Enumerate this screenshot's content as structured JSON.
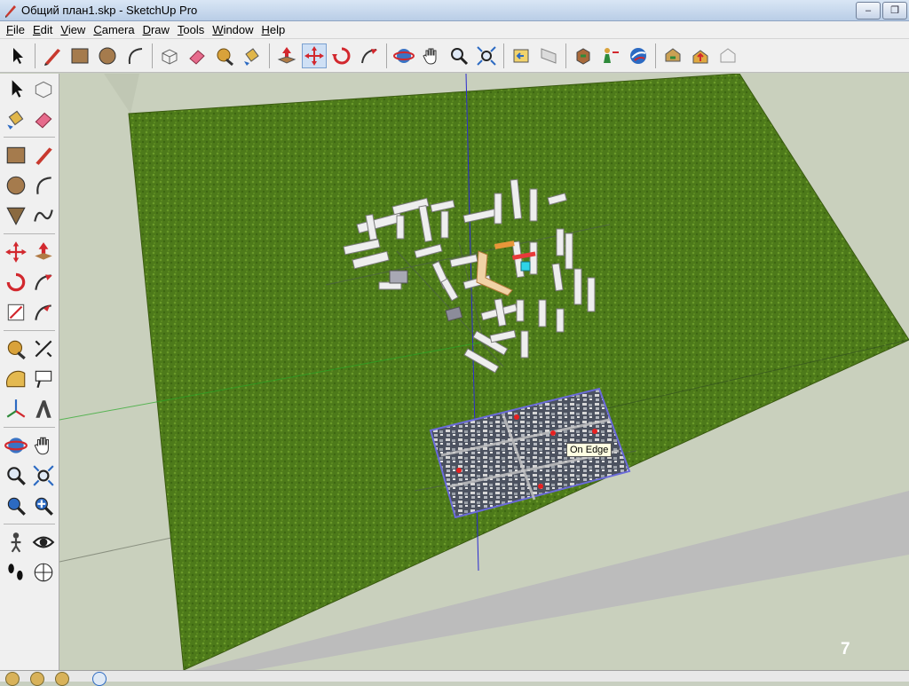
{
  "window": {
    "title": "Общий план1.skp - SketchUp Pro",
    "minimize_label": "–",
    "restore_label": "❐"
  },
  "menu": [
    "File",
    "Edit",
    "View",
    "Camera",
    "Draw",
    "Tools",
    "Window",
    "Help"
  ],
  "toolbar": {
    "icons": [
      "select-icon",
      "pencil-icon",
      "rectangle-icon",
      "circle-icon",
      "arc-icon",
      "make-component-icon",
      "eraser-icon",
      "tape-measure-icon",
      "paint-bucket-icon",
      "push-pull-icon",
      "move-icon",
      "rotate-icon",
      "follow-me-icon",
      "orbit-icon",
      "pan-icon",
      "zoom-icon",
      "zoom-extents-icon",
      "previous-view-icon",
      "next-view-icon",
      "get-models-icon",
      "share-model-icon",
      "google-earth-icon",
      "components-icon",
      "upload-icon",
      "warehouse-icon"
    ]
  },
  "viewport": {
    "tooltip": "On Edge",
    "slide_number": "7",
    "colors": {
      "grass": "#4d7a1a",
      "ground": "#c9d0bd",
      "road": "#bcbcbc",
      "image_border": "#6a6ad8"
    }
  }
}
